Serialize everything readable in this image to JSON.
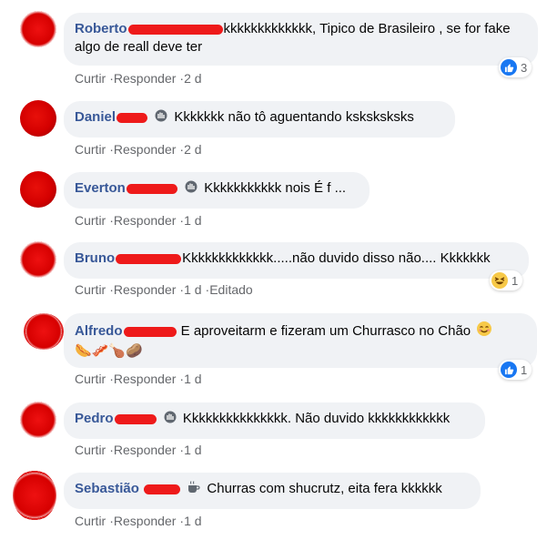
{
  "comments": [
    {
      "name": "Roberto",
      "text": "kkkkkkkkkkkkk, Tipico de Brasileiro , se for fake algo de reall deve ter",
      "actions": [
        "Curtir",
        "Responder",
        "2 d"
      ],
      "reaction": {
        "type": "like",
        "count": "3"
      }
    },
    {
      "name": "Daniel",
      "text": "Kkkkkkk não tô aguentando ksksksksks",
      "actions": [
        "Curtir",
        "Responder",
        "2 d"
      ]
    },
    {
      "name": "Everton",
      "text": "Kkkkkkkkkkk nois É f ...",
      "actions": [
        "Curtir",
        "Responder",
        "1 d"
      ]
    },
    {
      "name": "Bruno",
      "text": "Kkkkkkkkkkkkk.....não duvido disso não.... Kkkkkkk",
      "actions": [
        "Curtir",
        "Responder",
        "1 d",
        "Editado"
      ],
      "reaction": {
        "type": "haha",
        "count": "1"
      }
    },
    {
      "name": "Alfredo",
      "text": "E aproveitarm e fizeram um Churrasco no Chão",
      "emoji_line": "🌭🥓🍗🥔",
      "actions": [
        "Curtir",
        "Responder",
        "1 d"
      ],
      "reaction": {
        "type": "like",
        "count": "1"
      }
    },
    {
      "name": "Pedro",
      "text": "Kkkkkkkkkkkkkkk. Não duvido kkkkkkkkkkkk",
      "actions": [
        "Curtir",
        "Responder",
        "1 d"
      ]
    },
    {
      "name": "Sebastião",
      "text": "Churras com shucrutz, eita fera kkkkkk",
      "actions": [
        "Curtir",
        "Responder",
        "1 d"
      ]
    }
  ],
  "colors": {
    "author": "#385898",
    "bubble": "#f0f2f5",
    "meta": "#65676b",
    "like": "#1877f2"
  },
  "icons": [
    "wave-hand-icon",
    "like-icon",
    "haha-icon",
    "coffee-icon",
    "smile-icon"
  ]
}
